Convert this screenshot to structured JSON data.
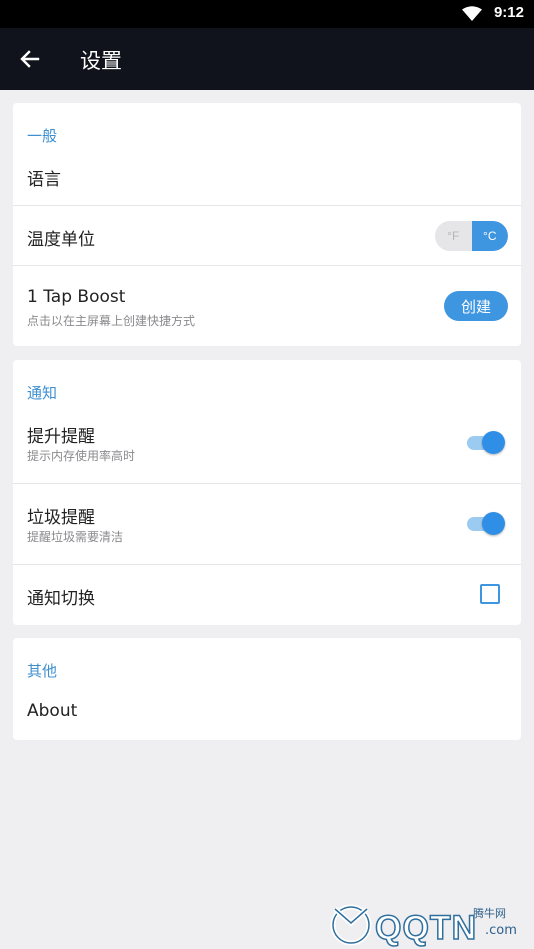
{
  "status_bar": {
    "time": "9:12",
    "wifi_icon": "wifi-icon"
  },
  "app_bar": {
    "title": "设置",
    "back_icon": "arrow-left-icon"
  },
  "general": {
    "section_title": "一般",
    "language_label": "语言",
    "temp_unit_label": "温度单位",
    "temp_unit_options": [
      "°F",
      "°C"
    ],
    "temp_unit_selected": "°C",
    "tap_boost_label": "1 Tap Boost",
    "tap_boost_sub": "点击以在主屏幕上创建快捷方式",
    "create_button": "创建"
  },
  "notify": {
    "section_title": "通知",
    "boost_label": "提升提醒",
    "boost_sub": "提示内存使用率高时",
    "boost_on": true,
    "junk_label": "垃圾提醒",
    "junk_sub": "提醒垃圾需要清洁",
    "junk_on": true,
    "toggle_label": "通知切换",
    "toggle_checked": false
  },
  "other": {
    "section_title": "其他",
    "about_label": "About"
  },
  "watermark": {
    "brand": "QQTN",
    "site_cn": "腾牛网",
    "domain": ".com"
  },
  "colors": {
    "accent": "#3e95e0",
    "appbar": "#11131c",
    "background": "#efeff2"
  }
}
